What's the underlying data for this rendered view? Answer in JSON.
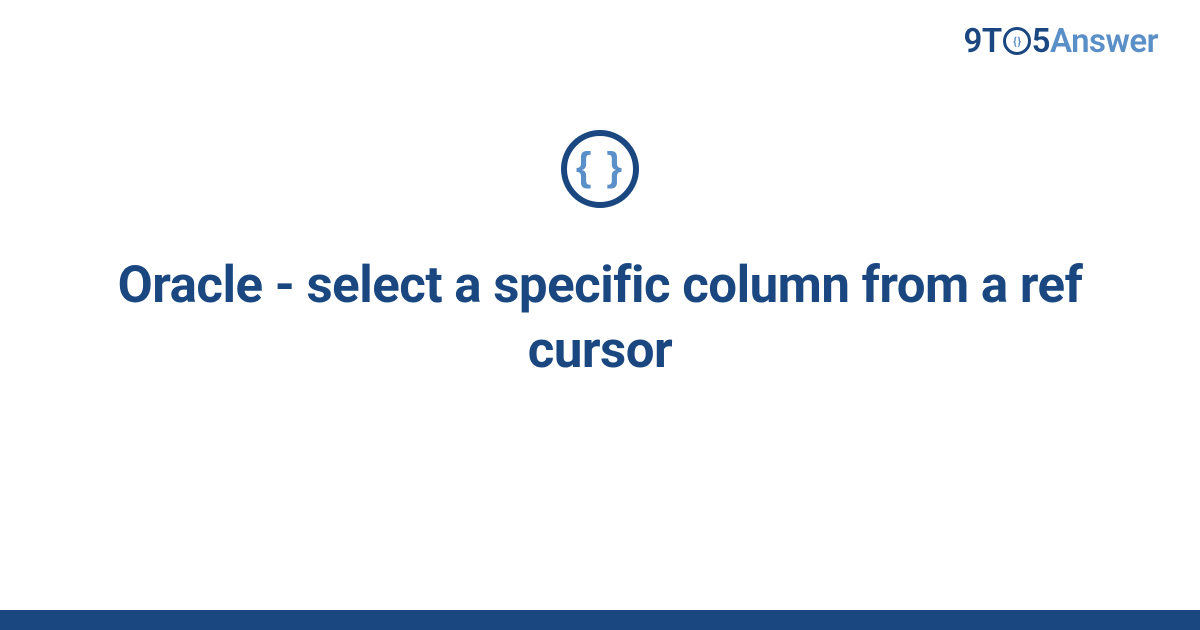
{
  "brand": {
    "nine": "9",
    "t": "T",
    "zero_inner": "{ }",
    "five": "5",
    "answer": "Answer"
  },
  "icon": {
    "braces": "{ }"
  },
  "title": "Oracle - select a specific column from a ref cursor"
}
